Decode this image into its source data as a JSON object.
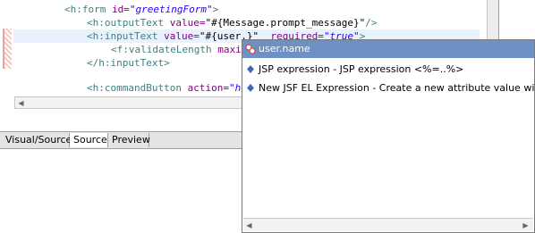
{
  "editor": {
    "lines": [
      {
        "segments": [
          {
            "cls": "tag",
            "t": "<h:form "
          },
          {
            "cls": "attr",
            "t": "id="
          },
          {
            "cls": "aval",
            "t": "\"greetingForm\""
          },
          {
            "cls": "tag",
            "t": ">"
          }
        ]
      },
      {
        "segments": [
          {
            "cls": "tag",
            "t": "<h:outputText "
          },
          {
            "cls": "attr",
            "t": "value="
          },
          {
            "cls": "plain",
            "t": "\"#{Message.prompt_message}\""
          },
          {
            "cls": "tag",
            "t": "/>"
          }
        ]
      },
      {
        "segments": [
          {
            "cls": "tag",
            "t": "<h:inputText "
          },
          {
            "cls": "attr",
            "t": "value="
          },
          {
            "cls": "plain",
            "t": "\"#{user.}\""
          },
          {
            "cls": "plain",
            "t": "  "
          },
          {
            "cls": "attr",
            "t": "required="
          },
          {
            "cls": "aval",
            "t": "\"true\""
          },
          {
            "cls": "tag",
            "t": ">"
          }
        ]
      },
      {
        "segments": [
          {
            "cls": "tag",
            "t": "<f:validateLength "
          },
          {
            "cls": "attr",
            "t": "maxim"
          }
        ]
      },
      {
        "segments": [
          {
            "cls": "tag",
            "t": "</h:inputText>"
          }
        ]
      },
      {
        "segments": []
      },
      {
        "segments": [
          {
            "cls": "tag",
            "t": "<h:commandButton "
          },
          {
            "cls": "attr",
            "t": "action="
          },
          {
            "cls": "aval",
            "t": "\"he"
          }
        ]
      }
    ]
  },
  "tabs": {
    "visual_source": "Visual/Source",
    "source": "Source",
    "preview": "Preview"
  },
  "autocomplete": {
    "selected": "user.name",
    "items": [
      "JSP expression - JSP expression <%=..%>",
      "New JSF EL Expression - Create a new attribute value with #{}"
    ]
  }
}
